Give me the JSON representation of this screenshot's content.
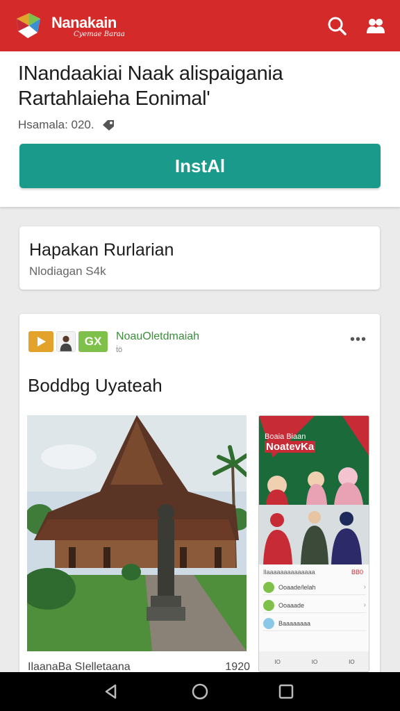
{
  "header": {
    "brand": "Nanakain",
    "brand_sub": "Cyemae Baraa",
    "colors": {
      "bar": "#d42a2a"
    },
    "icons": [
      "search-icon",
      "people-icon"
    ]
  },
  "app": {
    "title": "INandaakiai Naak alispaigania Rartahlaieha Eonimal'",
    "meta": "Hsamala: 020.",
    "install_label": "InstAl",
    "colors": {
      "install": "#1a9a8b"
    }
  },
  "info": {
    "title": "Hapakan Rurlarian",
    "subtitle": "Nlodiagan S4k"
  },
  "feed": {
    "source": "NoauOletdmaiah",
    "source_sub": "ṫö",
    "headline": "Boddbg Uyateah",
    "gx_label": "GX",
    "more": "•••",
    "caption": "IlaanaBa SIelletaana",
    "caption_num": "1920"
  },
  "phone": {
    "banner_line1": "Boaia Biaan",
    "banner_line2": "NoatevKa",
    "list_head": "Ilaaaaaaaaaaaaaa",
    "list_count": "BB0",
    "rows": [
      "Ooaade/lelah",
      "Ooaaade",
      "Baaaaaaaa"
    ],
    "nav": [
      "IO",
      "IO",
      "IO"
    ]
  },
  "sysnav": {
    "icons": [
      "back-icon",
      "home-icon",
      "recent-apps-icon"
    ]
  }
}
